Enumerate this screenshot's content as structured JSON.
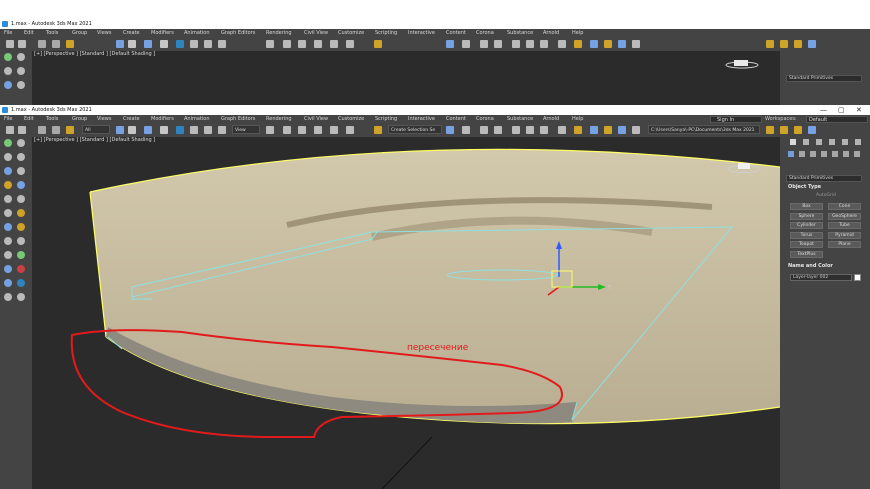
{
  "window_back": {
    "title": "1.max - Autodesk 3ds Max 2021",
    "viewport_label": "[+] [Perspective ] [Standard ] [Default Shading ]",
    "command_panel": {
      "dropdown": "Standard Primitives"
    }
  },
  "window": {
    "title": "1.max - Autodesk 3ds Max 2021",
    "controls": {
      "minimize": "—",
      "maximize": "▢",
      "close": "✕"
    }
  },
  "menu": [
    "File",
    "Edit",
    "Tools",
    "Group",
    "Views",
    "Create",
    "Modifiers",
    "Animation",
    "Graph Editors",
    "Rendering",
    "Civil View",
    "Customize",
    "Scripting",
    "Interactive",
    "Content",
    "Corona",
    "Substance",
    "Arnold",
    "Help"
  ],
  "sign_in": "Sign In",
  "workspaces": {
    "label": "Workspaces:",
    "value": "Default"
  },
  "toolbar": {
    "selection_filter": "All",
    "reference_coord": "View",
    "named_selection": "Create Selection Se",
    "project_path": "C:\\Users\\Sanya\\-PC\\Documents\\3ds Max 2021"
  },
  "viewport": {
    "label": "[+] [Perspective ] [Standard ] [Default Shading ]",
    "annotation": "пересечение",
    "gizmo_axis_y": "Y"
  },
  "command_panel": {
    "dropdown": "Standard Primitives",
    "object_type": {
      "header": "Object Type",
      "autogrid": "AutoGrid",
      "buttons": [
        "Box",
        "Cone",
        "Sphere",
        "GeoSphere",
        "Cylinder",
        "Tube",
        "Torus",
        "Pyramid",
        "Teapot",
        "Plane",
        "TextPlus"
      ]
    },
    "name_color": {
      "header": "Name and Color",
      "name": "Layer-layer 002"
    }
  },
  "colors": {
    "ui_bg": "#444444",
    "viewport_bg": "#2b2b2b",
    "object_fill": "#c8bca0",
    "selection_outline": "#ffff66",
    "intersection_outline": "#e31a1c",
    "annotation_text": "#e31a1c",
    "plane_edges": "#8ee0e0"
  }
}
